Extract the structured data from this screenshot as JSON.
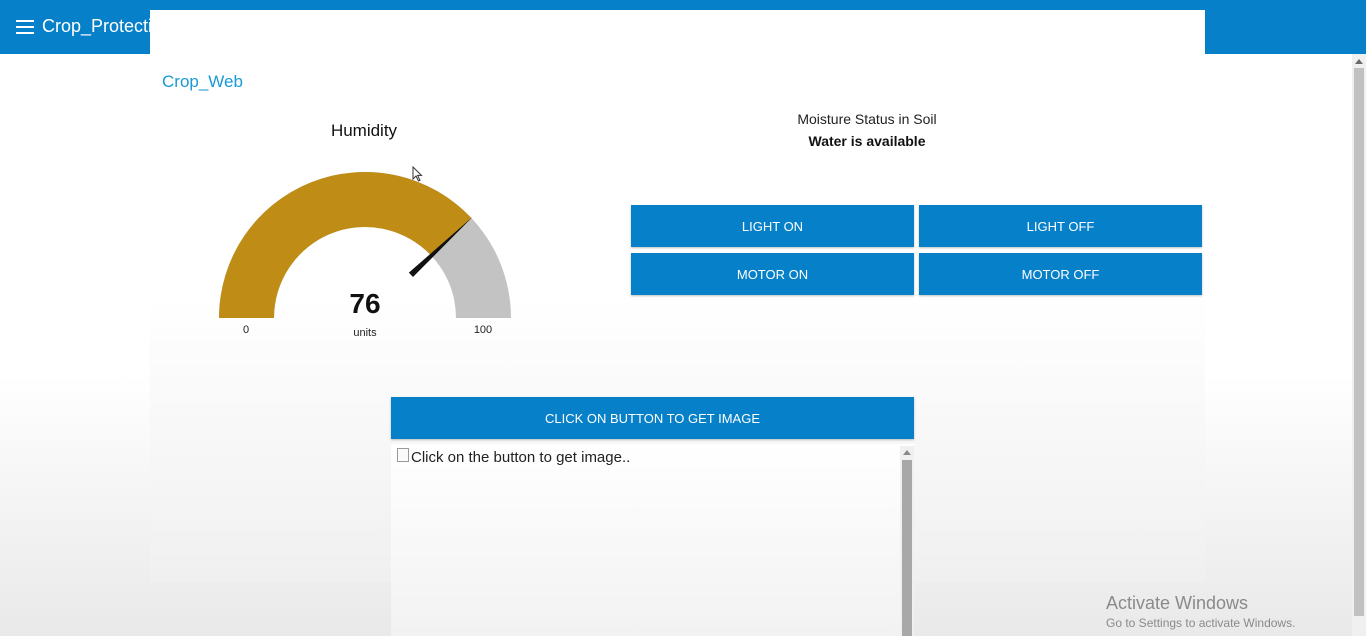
{
  "header": {
    "menu_icon": "hamburger-menu-icon",
    "title": "Crop_Protection"
  },
  "group": {
    "title": "Crop_Web"
  },
  "gauge": {
    "title": "Humidity",
    "value": "76",
    "numeric_value": 76,
    "units": "units",
    "min": "0",
    "max": "100",
    "min_value": 0,
    "max_value": 100,
    "fill_color": "#bf8d16",
    "track_color": "#c3c3c3"
  },
  "moisture": {
    "label": "Moisture Status in Soil",
    "value": "Water is available"
  },
  "buttons": {
    "light_on": "LIGHT ON",
    "light_off": "LIGHT OFF",
    "motor_on": "MOTOR ON",
    "motor_off": "MOTOR OFF",
    "get_image": "CLICK ON BUTTON TO GET IMAGE"
  },
  "image_panel": {
    "alt_text": "Click on the button to get image.."
  },
  "watermark": {
    "title": "Activate Windows",
    "subtitle": "Go to Settings to activate Windows."
  },
  "colors": {
    "accent": "#0680c8",
    "link": "#1a9ad6"
  }
}
